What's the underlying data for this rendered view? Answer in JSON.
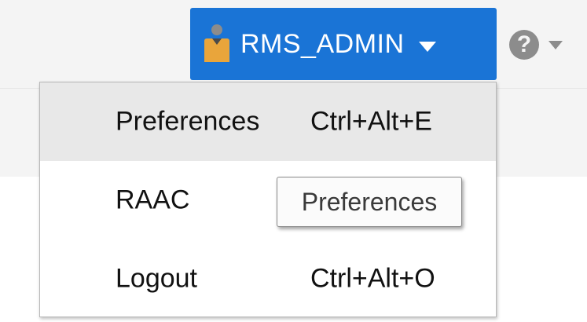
{
  "header": {
    "user_name": "RMS_ADMIN",
    "user_icon": "user-icon",
    "help_icon": "help-icon",
    "accent_color": "#1a74d6"
  },
  "user_menu": {
    "items": [
      {
        "label": "Preferences",
        "shortcut": "Ctrl+Alt+E",
        "highlighted": true
      },
      {
        "label": "RAAC",
        "shortcut": ""
      },
      {
        "label": "Logout",
        "shortcut": "Ctrl+Alt+O"
      }
    ]
  },
  "tooltip": {
    "text": "Preferences"
  }
}
